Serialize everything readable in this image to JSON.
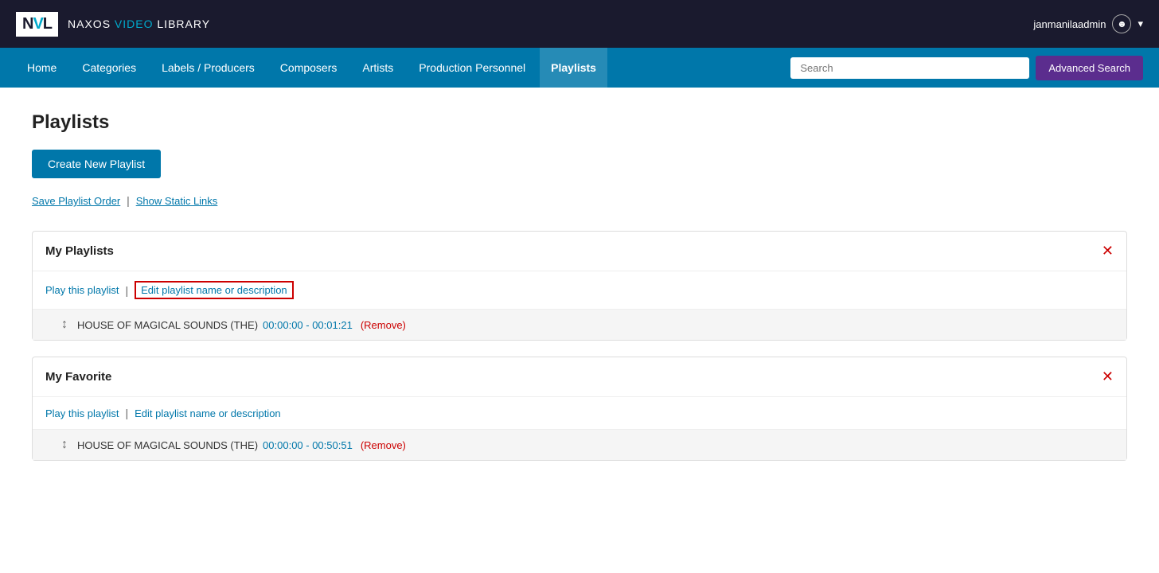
{
  "topbar": {
    "logo": "NVL",
    "logo_highlight": "V",
    "site_name_part1": "NAXOS ",
    "site_name_part2": "VIDEO",
    "site_name_part3": " LIBRARY",
    "username": "janmanilaadmin",
    "chevron": "▾"
  },
  "nav": {
    "items": [
      {
        "label": "Home",
        "active": false
      },
      {
        "label": "Categories",
        "active": false
      },
      {
        "label": "Labels / Producers",
        "active": false
      },
      {
        "label": "Composers",
        "active": false
      },
      {
        "label": "Artists",
        "active": false
      },
      {
        "label": "Production Personnel",
        "active": false
      },
      {
        "label": "Playlists",
        "active": true
      }
    ],
    "search_placeholder": "Search",
    "advanced_search_label": "Advanced Search"
  },
  "page": {
    "title": "Playlists",
    "create_btn": "Create New Playlist",
    "save_order_link": "Save Playlist Order",
    "separator": "|",
    "static_links_link": "Show Static Links"
  },
  "playlists": [
    {
      "id": "my-playlists",
      "name": "My Playlists",
      "play_link": "Play this playlist",
      "edit_link": "Edit playlist name or description",
      "edit_highlighted": true,
      "tracks": [
        {
          "title": "HOUSE OF MAGICAL SOUNDS (THE)",
          "time_start": "00:00:00",
          "time_end": "00:01:21",
          "time_display": "00:00:00 - 00:01:21",
          "remove": "Remove"
        }
      ]
    },
    {
      "id": "my-favorite",
      "name": "My Favorite",
      "play_link": "Play this playlist",
      "edit_link": "Edit playlist name or description",
      "edit_highlighted": false,
      "tracks": [
        {
          "title": "HOUSE OF MAGICAL SOUNDS (THE)",
          "time_start": "00:00:00",
          "time_end": "00:50:51",
          "time_display": "00:00:00 - 00:50:51",
          "remove": "Remove"
        }
      ]
    }
  ]
}
